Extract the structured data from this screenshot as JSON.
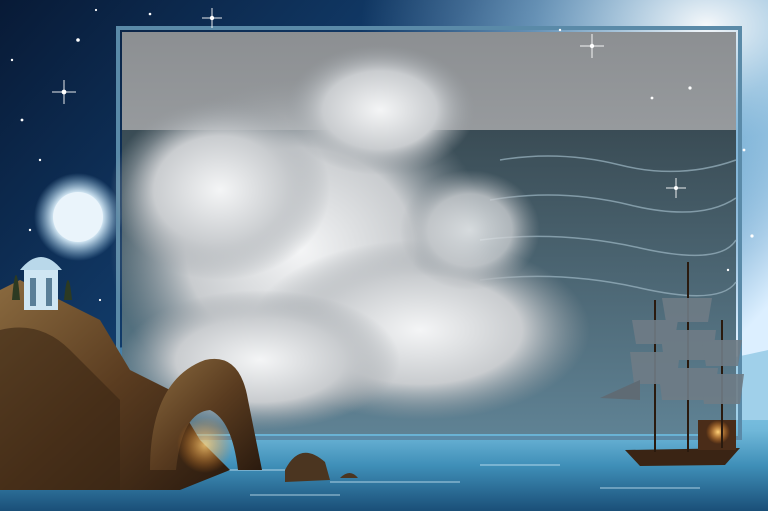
{
  "colors": {
    "sky_top": "#0a1f3d",
    "sky_mid": "#1d5a8a",
    "sky_glow": "#e8f4fb",
    "sea_far": "#2b4a5c",
    "sea_near": "#8fd0ea",
    "frame": "#5a8aa8",
    "moon": "#e9f3fb",
    "rock": "#6b4a2a",
    "lantern": "#ffb347",
    "ship_hull": "#3a2414",
    "sail": "#6f7c86"
  },
  "objects": [
    "starry-night-sky",
    "full-moon",
    "framed-storm-wave-photo",
    "rocky-cliff-with-gazebo",
    "natural-rock-arch",
    "sailing-ship",
    "calm-moonlit-sea"
  ]
}
